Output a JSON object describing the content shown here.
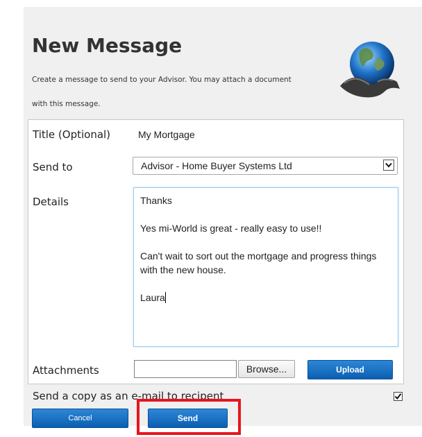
{
  "page": {
    "title": "New Message",
    "intro_line1": "Create a message to send to your Advisor. You may attach a document",
    "intro_line2": "with this message."
  },
  "form": {
    "title_label": "Title (Optional)",
    "title_value": "My Mortgage",
    "send_to_label": "Send to",
    "send_to_selected": "Advisor - Home Buyer Systems Ltd",
    "details_label": "Details",
    "details_lines": [
      "Thanks",
      "Yes mi-World is great - really easy to use!!",
      "Can't wait to sort out the mortgage and progress things with the new house.",
      "Laura"
    ],
    "attachments_label": "Attachments",
    "browse_label": "Browse...",
    "upload_label": "Upload",
    "copy_email_label": "Send a copy as an e-mail to recipent",
    "copy_email_checked": true
  },
  "actions": {
    "cancel_label": "Cancel",
    "send_label": "Send"
  },
  "icons": {
    "globe": "globe-in-hands-icon",
    "dropdown": "chevron-down-icon",
    "checkbox": "checkmark-icon"
  },
  "colors": {
    "primary_button": "#0b5fb2",
    "highlight": "#e8141c",
    "panel_background": "#f0f0f0"
  }
}
